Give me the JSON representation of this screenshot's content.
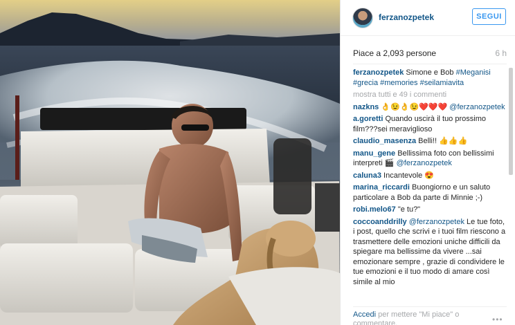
{
  "post": {
    "username": "ferzanozpetek",
    "follow_label": "SEGUI",
    "likes": "Piace a 2,093 persone",
    "time": "6 h",
    "caption_user": "ferzanozpetek",
    "caption_text": "Simone e Bob",
    "caption_tags": "#Meganisi #grecia #memories #seilamiavita",
    "more_comments": "mostra tutti e 49 i commenti"
  },
  "comments": [
    {
      "user": "nazkns",
      "text": "👌😉👌😉❤️❤️❤️",
      "mention": "@ferzanozpetek"
    },
    {
      "user": "a.goretti",
      "text": "Quando uscirà il tuo prossimo film???sei meraviglioso",
      "mention": ""
    },
    {
      "user": "claudio_masenza",
      "text": "Belli!! 👍👍👍",
      "mention": ""
    },
    {
      "user": "manu_gene",
      "text": "Bellissima foto con bellissimi interpreti 🎬",
      "mention": "@ferzanozpetek"
    },
    {
      "user": "caluna3",
      "text": "Incantevole 😍",
      "mention": ""
    },
    {
      "user": "marina_riccardi",
      "text": "Buongiorno e un saluto particolare a Bob da parte di Minnie ;-)",
      "mention": ""
    },
    {
      "user": "robi.melo67",
      "text": "\"e tu?\"",
      "mention": ""
    },
    {
      "user": "coccoanddrilly",
      "text": "Le tue foto, i post, quello che scrivi e i tuoi film riescono a trasmettere delle emozioni uniche difficili da spiegare ma bellissime da vivere ...sai emozionare sempre , grazie di condividere le tue emozioni e il tuo modo di amare così simile al mio",
      "mention": "@ferzanozpetek",
      "mention_first": true
    }
  ],
  "footer": {
    "login_link": "Accedi",
    "login_text": "per mettere \"Mi piace\" o commentare.",
    "more_icon": "ellipsis-icon"
  },
  "colors": {
    "link": "#125688",
    "follow": "#3897f0",
    "muted": "#a5a7aa"
  }
}
